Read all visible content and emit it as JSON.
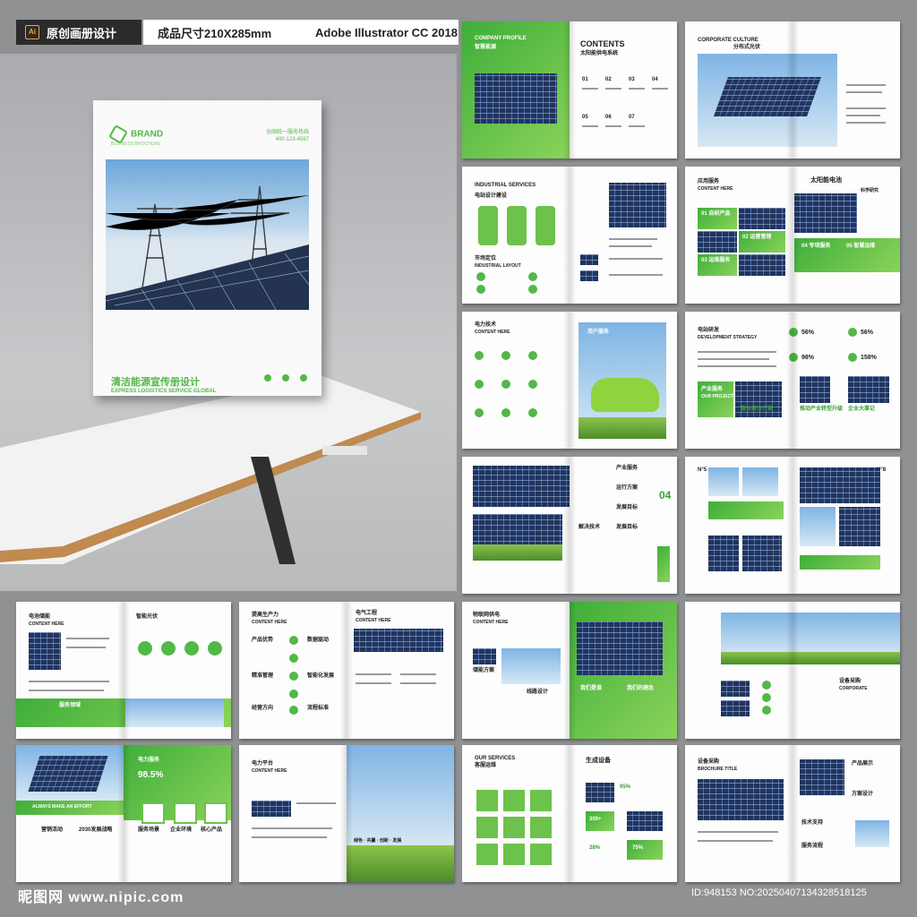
{
  "header": {
    "app_badge": "Ai",
    "tag_1": "原创画册设计",
    "tag_2": "成品尺寸210X285mm",
    "tag_3": "Adobe Illustrator CC 2018"
  },
  "cover": {
    "brand": "BRAND",
    "brand_sub": "BUSINESS BROCHURE",
    "phone_label": "全国统一服务热线",
    "phone": "400-123-4567",
    "title": "清洁能源宣传册设计",
    "subtitle": "EXPRESS LOGISTICS SERVICE GLOBAL"
  },
  "spreads": {
    "s1_profile": "COMPANY PROFILE",
    "s1_profile_cn": "智慧能源",
    "s1_contents": "CONTENTS",
    "s1_contents_cn": "太阳能供电系统",
    "s1_nums": [
      "01",
      "02",
      "03",
      "04",
      "05",
      "06",
      "07"
    ],
    "s2_title": "CORPORATE CULTURE",
    "s2_title_cn": "分布式光伏",
    "s3_title": "INDUSTRIAL SERVICES",
    "s3_title_cn": "电站设计建设",
    "s3_sub": "市场定位",
    "s3_sub2": "INDUSTRIAL LAYOUT",
    "s4_title": "应用服务",
    "s4_title_en": "CONTENT HERE",
    "s4_right": "太阳能电池",
    "s4_right_sub": "科学研究",
    "s4_items": [
      "01 自研产品",
      "02 运营管理",
      "03 运维服务",
      "04 专项服务",
      "05 智慧运维"
    ],
    "s5_title": "电力技术",
    "s5_title_en": "CONTENT HERE",
    "s5_right": "用户服务",
    "s6_title": "电站研发",
    "s6_title_en": "DEVELOPMENT STRATEGY",
    "s6_stats": [
      "56%",
      "56%",
      "98%",
      "158%"
    ],
    "s6_box": "产业服务",
    "s6_box_en": "OUR PROJECT",
    "s6_labels": [
      "整体解决方案",
      "推动产业转型升级",
      "企业大事记"
    ],
    "s7_labels": [
      "产业服务",
      "运行方案",
      "发展目标",
      "发展目标",
      "解决技术"
    ],
    "s7_num": "04",
    "s8_no": "N°5",
    "s8_no_right": "N°8",
    "s9_title": "电池储能",
    "s9_title_en": "CONTENT HERE",
    "s9_right": "智能光伏",
    "s9_banner": "服务领域",
    "s10_title": "提高生产力",
    "s10_title_en": "CONTENT HERE",
    "s10_right": "电气工程",
    "s10_right_en": "CONTENT HERE",
    "s10_labels": [
      "产品优势",
      "精准管理",
      "经营方向",
      "数据驱动",
      "智能化发展",
      "流程标准"
    ],
    "s11_title": "物联网供电",
    "s11_title_en": "CONTENT HERE",
    "s11_labels": [
      "储能方案",
      "线路设计",
      "我们是谁",
      "我们的理念"
    ],
    "s12_title": "设备采购",
    "s12_title_en": "CORPORATE",
    "s13_title": "电力服务",
    "s13_stat": "98.5%",
    "s13_banner": "ALWAYS MAKE AN EFFORT",
    "s13_labels": [
      "营销活动",
      "2030发展战略",
      "服务场景",
      "企业环境",
      "核心产品"
    ],
    "s14_title": "电力平台",
    "s14_title_en": "CONTENT HERE",
    "s14_caption": "绿色 · 共赢 · 创新 · 发展",
    "s15_title": "OUR SERVICES",
    "s15_title_cn": "客服运维",
    "s15_right": "生成设备",
    "s15_stats": [
      "95%",
      "300+",
      "75%",
      "28%"
    ],
    "s16_title": "设备采购",
    "s16_title_en": "BROCHURE TITLE",
    "s16_labels": [
      "产品展示",
      "方案设计",
      "技术支持",
      "服务流程"
    ]
  },
  "footer": {
    "watermark": "昵图网 www.nipic.com",
    "id": "ID:948153 NO:20250407134328518125"
  },
  "colors": {
    "accent": "#52b848",
    "accent_light": "#8ad35a",
    "background": "#8f9193"
  }
}
